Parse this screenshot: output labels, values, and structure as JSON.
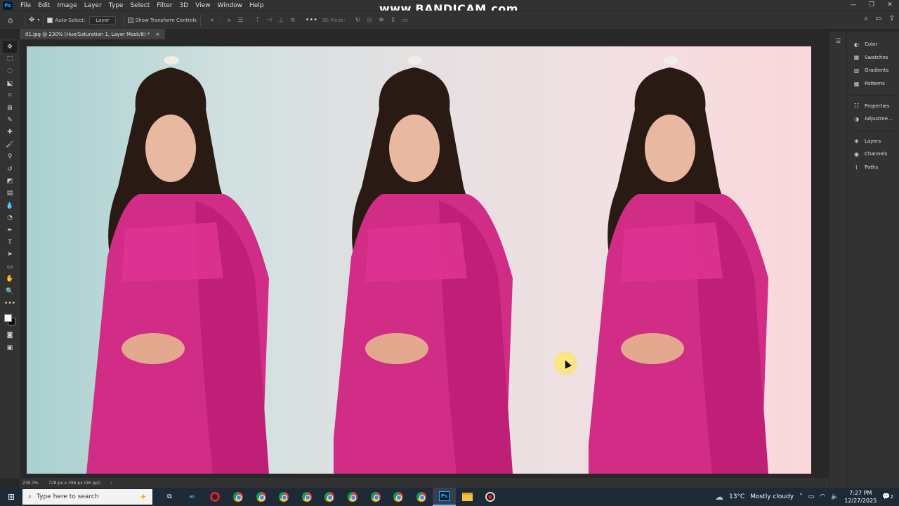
{
  "app": {
    "logo": "Ps"
  },
  "menu": [
    "File",
    "Edit",
    "Image",
    "Layer",
    "Type",
    "Select",
    "Filter",
    "3D",
    "View",
    "Window",
    "Help"
  ],
  "watermark": "www.BANDICAM.com",
  "options": {
    "auto_select_label": "Auto-Select:",
    "layer_select": "Layer",
    "transform_label": "Show Transform Controls",
    "mode_label": "3D Mode:"
  },
  "document": {
    "tab_title": "01.jpg @ 230% (Hue/Saturation 1, Layer Mask/8) *",
    "close": "×"
  },
  "status": {
    "zoom": "230.3%",
    "dimensions": "728 px x 396 px (96 ppi)",
    "arrow": "›"
  },
  "panels": [
    {
      "label": "Color",
      "icon": "color-wheel-icon"
    },
    {
      "label": "Swatches",
      "icon": "grid-icon"
    },
    {
      "label": "Gradients",
      "icon": "gradient-icon"
    },
    {
      "label": "Patterns",
      "icon": "pattern-icon"
    },
    {
      "label": "Properties",
      "icon": "sliders-icon"
    },
    {
      "label": "Adjustme...",
      "icon": "adjustment-icon"
    },
    {
      "label": "Layers",
      "icon": "layers-icon"
    },
    {
      "label": "Channels",
      "icon": "channels-icon"
    },
    {
      "label": "Paths",
      "icon": "paths-icon"
    }
  ],
  "taskbar": {
    "search_placeholder": "Type here to search",
    "weather_temp": "13°C",
    "weather_desc": "Mostly cloudy",
    "time": "7:27 PM",
    "date": "12/27/2025",
    "notification_count": "2"
  }
}
